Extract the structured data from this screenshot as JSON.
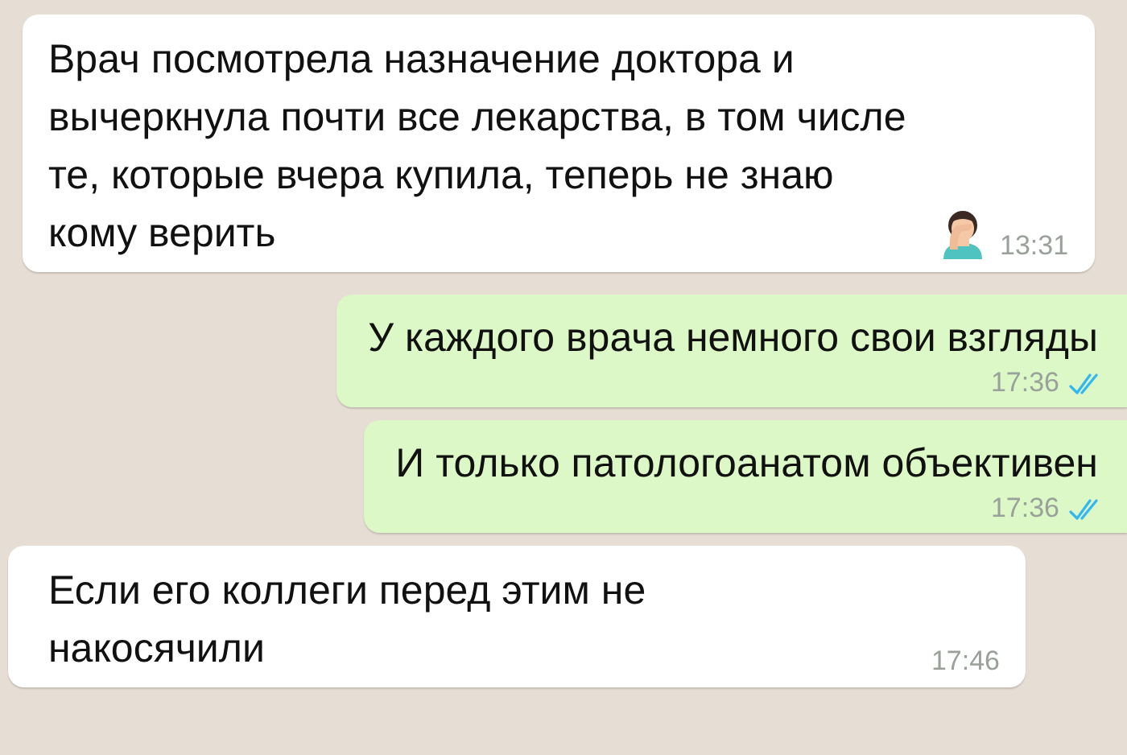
{
  "messages": [
    {
      "kind": "incoming",
      "text": "Врач посмотрела назначение доктора и вычеркнула почти все лекарства, в том числе те, которые вчера купила, теперь не знаю кому верить",
      "emoji": true,
      "time": "13:31"
    },
    {
      "kind": "outgoing",
      "text": "У каждого врача немного свои взгляды",
      "time": "17:36",
      "read": true
    },
    {
      "kind": "outgoing",
      "text": "И только патологоанатом объективен",
      "time": "17:36",
      "read": true
    },
    {
      "kind": "incoming",
      "text": "Если его коллеги перед этим не накосячили",
      "time": "17:46"
    }
  ]
}
